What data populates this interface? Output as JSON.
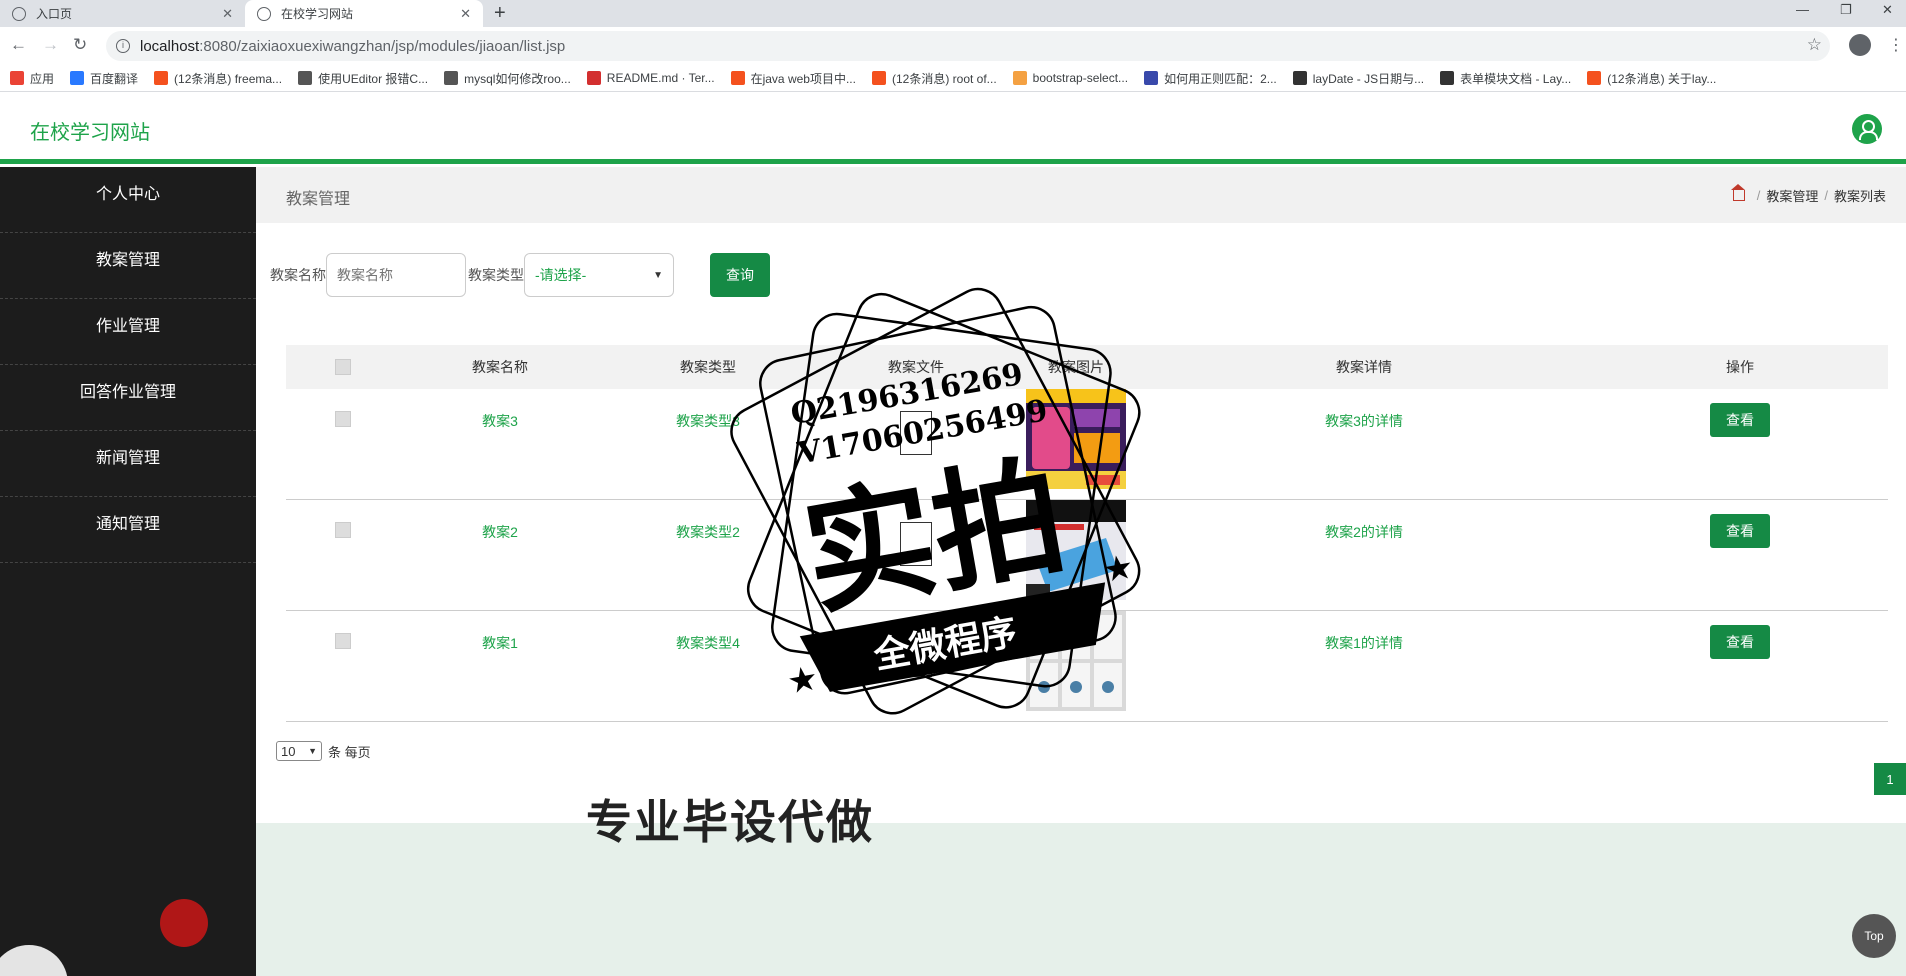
{
  "browser": {
    "tabs": [
      {
        "label": "入口页",
        "active": false
      },
      {
        "label": "在校学习网站",
        "active": true
      }
    ],
    "url_host": "localhost",
    "url_path": ":8080/zaixiaoxuexiwangzhan/jsp/modules/jiaoan/list.jsp",
    "bookmarks": [
      {
        "label": "应用",
        "color": "#ea4335"
      },
      {
        "label": "百度翻译",
        "color": "#2979ff"
      },
      {
        "label": "(12条消息) freema...",
        "color": "#f4511e"
      },
      {
        "label": "使用UEditor 报错C...",
        "color": "#555555"
      },
      {
        "label": "mysql如何修改roo...",
        "color": "#555555"
      },
      {
        "label": "README.md · Ter...",
        "color": "#d32f2f"
      },
      {
        "label": "在java web项目中...",
        "color": "#f4511e"
      },
      {
        "label": "(12条消息) root of...",
        "color": "#f4511e"
      },
      {
        "label": "bootstrap-select...",
        "color": "#f4a142"
      },
      {
        "label": "如何用正则匹配：2...",
        "color": "#3949ab"
      },
      {
        "label": "layDate - JS日期与...",
        "color": "#333333"
      },
      {
        "label": "表单模块文档 - Lay...",
        "color": "#333333"
      },
      {
        "label": "(12条消息) 关于lay...",
        "color": "#f4511e"
      }
    ]
  },
  "app": {
    "title": "在校学习网站",
    "accent": "#1ea34a"
  },
  "sidebar": {
    "items": [
      "个人中心",
      "教案管理",
      "作业管理",
      "回答作业管理",
      "新闻管理",
      "通知管理"
    ]
  },
  "main": {
    "page_title": "教案管理",
    "breadcrumb": [
      "教案管理",
      "教案列表"
    ],
    "search": {
      "name_label": "教案名称",
      "name_placeholder": "教案名称",
      "type_label": "教案类型",
      "type_selected": "-请选择-",
      "query_label": "查询"
    },
    "table": {
      "headers": [
        "教案名称",
        "教案类型",
        "教案文件",
        "教案图片",
        "教案详情",
        "操作"
      ],
      "rows": [
        {
          "name": "教案3",
          "type": "教案类型3",
          "detail": "教案3的详情",
          "action": "查看"
        },
        {
          "name": "教案2",
          "type": "教案类型2",
          "detail": "教案2的详情",
          "action": "查看"
        },
        {
          "name": "教案1",
          "type": "教案类型4",
          "detail": "教案1的详情",
          "action": "查看"
        }
      ]
    },
    "pager": {
      "page_size": "10",
      "per_page_label": "条 每页",
      "current_page": "1"
    },
    "footer_text": "专业毕设代做",
    "top_label": "Top"
  },
  "watermark": {
    "line1": "Q2196316269",
    "line2": "V17060256499",
    "big": "实拍",
    "banner": "全微程序"
  }
}
